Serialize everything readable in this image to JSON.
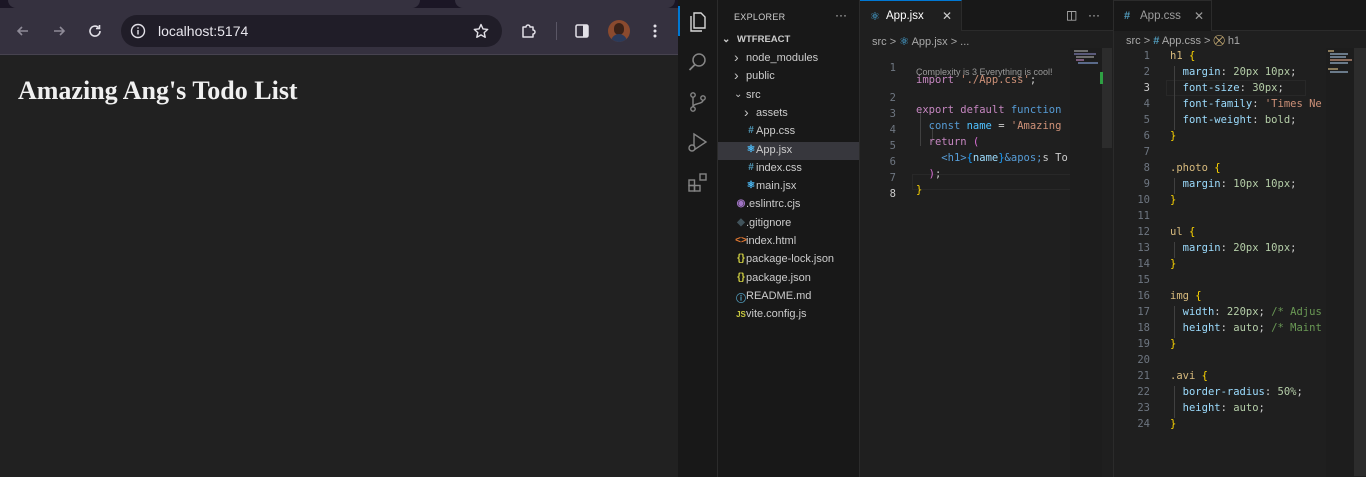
{
  "browser": {
    "url": "localhost:5174",
    "page_heading": "Amazing Ang's Todo List"
  },
  "vscode": {
    "explorer_title": "EXPLORER",
    "explorer_more": "···",
    "project_name": "WTFREACT",
    "tree": [
      {
        "label": "node_modules",
        "type": "folder",
        "expanded": false
      },
      {
        "label": "public",
        "type": "folder",
        "expanded": false
      },
      {
        "label": "src",
        "type": "folder",
        "expanded": true
      },
      {
        "label": "assets",
        "type": "folder",
        "expanded": false
      },
      {
        "label": "App.css",
        "type": "css",
        "icon": "#"
      },
      {
        "label": "App.jsx",
        "type": "react",
        "icon": "⚛",
        "selected": true
      },
      {
        "label": "index.css",
        "type": "css",
        "icon": "#"
      },
      {
        "label": "main.jsx",
        "type": "react",
        "icon": "⚛"
      },
      {
        "label": ".eslintrc.cjs",
        "type": "eslint",
        "icon": "◉"
      },
      {
        "label": ".gitignore",
        "type": "git",
        "icon": "◆"
      },
      {
        "label": "index.html",
        "type": "html",
        "icon": "<>"
      },
      {
        "label": "package-lock.json",
        "type": "json",
        "icon": "{}"
      },
      {
        "label": "package.json",
        "type": "json",
        "icon": "{}"
      },
      {
        "label": "README.md",
        "type": "info",
        "icon": "ⓘ"
      },
      {
        "label": "vite.config.js",
        "type": "js",
        "icon": "JS"
      }
    ],
    "left_editor": {
      "tab_label": "App.jsx",
      "tab_icon": "⚛",
      "tab_close": "✕",
      "actions_split": "◫",
      "actions_more": "···",
      "breadcrumb": {
        "src": "src",
        "sep": ">",
        "file_icon": "⚛",
        "file": "App.jsx",
        "rest": "> ..."
      },
      "codelens": "Complexity is 3 Everything is cool!",
      "line_numbers": [
        "1",
        "2",
        "3",
        "4",
        "5",
        "6",
        "7",
        "8"
      ],
      "lines": {
        "l1": {
          "kw": "import",
          "str": "'./App.css'",
          "end": ";"
        },
        "l2": {
          "kw": "export",
          "kw2": "default",
          "kw3": "function"
        },
        "l3": {
          "kw": "const",
          "var": "name",
          "op": "=",
          "str": "'Amazing"
        },
        "l4": {
          "kw": "return",
          "paren": "("
        },
        "l5": {
          "open": "<h1>",
          "brace_open": "{",
          "expr": "name",
          "brace_close": "}",
          "entity": "&apos;",
          "rest": "s To"
        },
        "l6": {
          "paren": ")",
          "end": ";"
        },
        "l7": {
          "brace": "}"
        }
      }
    },
    "right_editor": {
      "tab_label": "App.css",
      "tab_icon": "#",
      "tab_close": "✕",
      "breadcrumb": {
        "src": "src",
        "sep": ">",
        "file_icon": "#",
        "file": "App.css",
        "sep2": ">",
        "sym_icon": "⛒",
        "symbol": "h1"
      },
      "line_numbers": [
        "1",
        "2",
        "3",
        "4",
        "5",
        "6",
        "7",
        "8",
        "9",
        "10",
        "11",
        "12",
        "13",
        "14",
        "15",
        "16",
        "17",
        "18",
        "19",
        "20",
        "21",
        "22",
        "23",
        "24"
      ],
      "css": [
        {
          "sel": "h1",
          "open": "{"
        },
        {
          "prop": "margin",
          "val": "20px 10px",
          "end": ";"
        },
        {
          "prop": "font-size",
          "val": "30px",
          "end": ";"
        },
        {
          "prop": "font-family",
          "str": "'Times Ne"
        },
        {
          "prop": "font-weight",
          "val": "bold",
          "end": ";"
        },
        {
          "close": "}"
        },
        {},
        {
          "sel": ".photo",
          "open": "{"
        },
        {
          "prop": "margin",
          "val": "10px 10px",
          "end": ";"
        },
        {
          "close": "}"
        },
        {},
        {
          "sel": "ul",
          "open": "{"
        },
        {
          "prop": "margin",
          "val": "20px 10px",
          "end": ";"
        },
        {
          "close": "}"
        },
        {},
        {
          "sel": "img",
          "open": "{"
        },
        {
          "prop": "width",
          "val": "220px",
          "end": ";",
          "cmt": "/* Adjus"
        },
        {
          "prop": "height",
          "val": "auto",
          "end": ";",
          "cmt": "/* Maint"
        },
        {
          "close": "}"
        },
        {},
        {
          "sel": ".avi",
          "open": "{"
        },
        {
          "prop": "border-radius",
          "val": "50%",
          "end": ";"
        },
        {
          "prop": "height",
          "val": "auto",
          "end": ";"
        },
        {
          "close": "}"
        }
      ]
    }
  },
  "colors": {
    "accent": "#0078d4",
    "browser_toolbar": "#35313f",
    "page_bg": "#212121",
    "editor_bg": "#1f1f1f"
  }
}
